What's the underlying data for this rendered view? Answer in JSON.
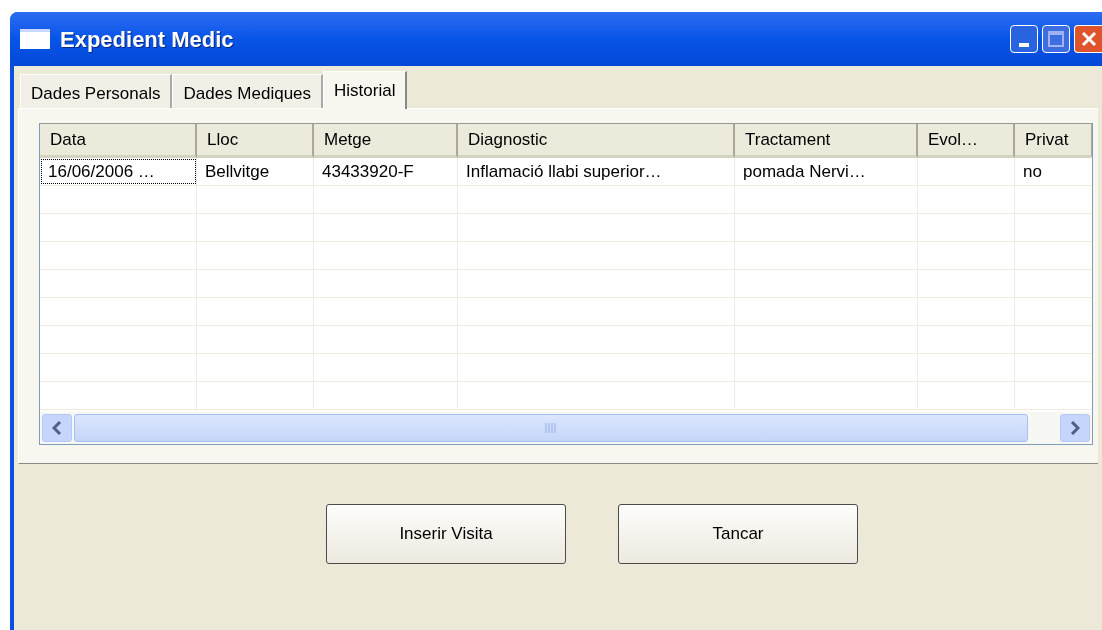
{
  "window": {
    "title": "Expedient Medic"
  },
  "tabs": [
    {
      "label": "Dades Personals",
      "selected": false
    },
    {
      "label": "Dades Mediques",
      "selected": false
    },
    {
      "label": "Historial",
      "selected": true
    }
  ],
  "table": {
    "columns": [
      "Data",
      "Lloc",
      "Metge",
      "Diagnostic",
      "Tractament",
      "Evol…",
      "Privat"
    ],
    "rows": [
      {
        "cells": [
          "16/06/2006 …",
          "Bellvitge",
          "43433920-F",
          "Inflamació llabi superior…",
          "pomada Nervi…",
          "",
          "no"
        ],
        "focused": true
      }
    ]
  },
  "buttons": [
    "Inserir Visita",
    "Tancar"
  ]
}
